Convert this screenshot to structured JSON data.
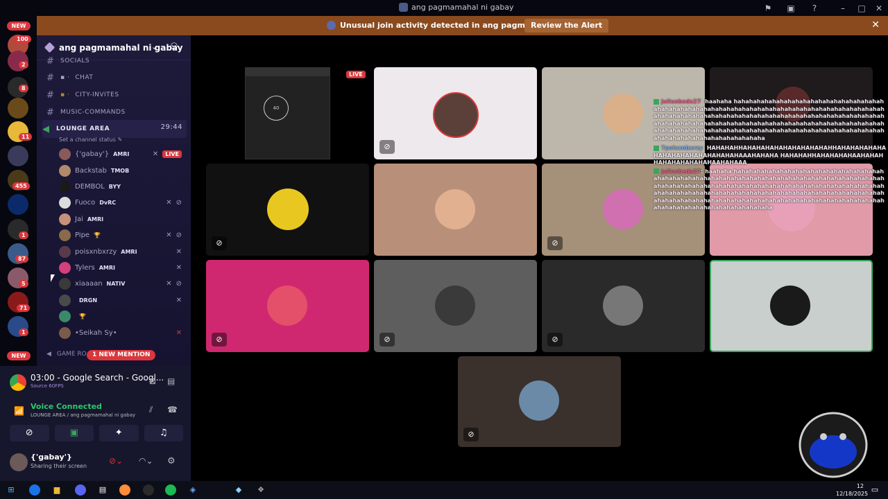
{
  "window": {
    "title": "ang pagmamahal ni gabay"
  },
  "banner": {
    "message": "Unusual join activity detected in ang pagmamahal ni gabay",
    "review_label": "Review the Alert"
  },
  "servers": {
    "new_top": "NEW",
    "new_bottom": "NEW",
    "badges": [
      "100",
      "2",
      "8",
      "11",
      "455",
      "1",
      "87",
      "5",
      "71",
      "1"
    ]
  },
  "guild": {
    "name": "ang pagmamahal ni gabay"
  },
  "channels": {
    "socials": "SOCIALS",
    "chat": "CHAT",
    "city_invites": "CITY-INVITES",
    "music_commands": "MUSIC-COMMANDS",
    "lounge": "LOUNGE AREA",
    "lounge_time": "29:44",
    "status_hint": "Set a channel status",
    "game_room": "GAME RO",
    "new_mention": "1 NEW MENTION"
  },
  "voice_users": [
    {
      "name": "{'gabay'}",
      "tag": "AMRI",
      "live": "LIVE"
    },
    {
      "name": "Backstab",
      "tag": "TMOB"
    },
    {
      "name": "DEMBOL",
      "tag": "BYY"
    },
    {
      "name": "Fuoco",
      "tag": "DvRC"
    },
    {
      "name": "Jai",
      "tag": "AMRI"
    },
    {
      "name": "Pipe",
      "tag": "🏆"
    },
    {
      "name": "poisxnbxrzy",
      "tag": "AMRI"
    },
    {
      "name": "Tylers",
      "tag": "AMRI"
    },
    {
      "name": "xiaaaan",
      "tag": "NATIV"
    },
    {
      "name": "",
      "tag": "DRGN"
    },
    {
      "name": "",
      "tag": "🏆"
    },
    {
      "name": "•Seikah Sy•",
      "tag": ""
    }
  ],
  "stream": {
    "title": "03:00 - Google Search - Googl...",
    "source": "Source 60FPS"
  },
  "voice": {
    "status": "Voice Connected",
    "location": "LOUNGE AREA / ang pagmamahal ni gabay"
  },
  "user": {
    "name": "{'gabay'}",
    "status": "Sharing their screen"
  },
  "stage": {
    "live_label": "LIVE",
    "screenshare_counter": "40"
  },
  "chat_overlay": [
    {
      "user": "juliusbeds27",
      "text": ": haahaha hahahahahahahahahahahahahahahahahahahahahahahahahahahahahahahahahahahahahahahahahahahahahahahahahahahahahahahahahahahahahahahahahahahahahahahahahahahahahahahahahahahahahahahahahahahahahahahahahahahahahahahahahahahahahahahahahahahahahahahahahahahahahahahahahahahahahahahahahahahahahahahahahahahahahahahahahaha"
    },
    {
      "user": "7polsxnbxrzy",
      "text": ": HAHAHAHHAHAHAHAHAHAHAHAHAHAHHAHAHAHAHAHAHAHAHAHAHAHAHAHAHAHAAAHAHAHA HAHAHAHHAHAHAHAHAAHAHAHHAHAHAHAHAHAHAAHAHAAA"
    },
    {
      "user": "juliusbeds27",
      "text": ": haahaha hahahahahahahahahahahahahahahahahahahahahahahahahahahahahahahahahahahahahahahahahahahahahahahahahahahahahahahahahahahahahahahahahahahahahahahahahahahahahahahahahahahahahahahahahahahahahahahahahahahahahahahahahahahahahahahahahahahahahahahahahahahahahahahahahahahahahahahahahahahahahahahahahahahahahahahahahahaha"
    }
  ],
  "taskbar": {
    "time": "12",
    "date": "12/18/2025"
  },
  "colors": {
    "accent": "#da373c",
    "connected": "#23a55a",
    "banner": "#8a4a1e"
  }
}
